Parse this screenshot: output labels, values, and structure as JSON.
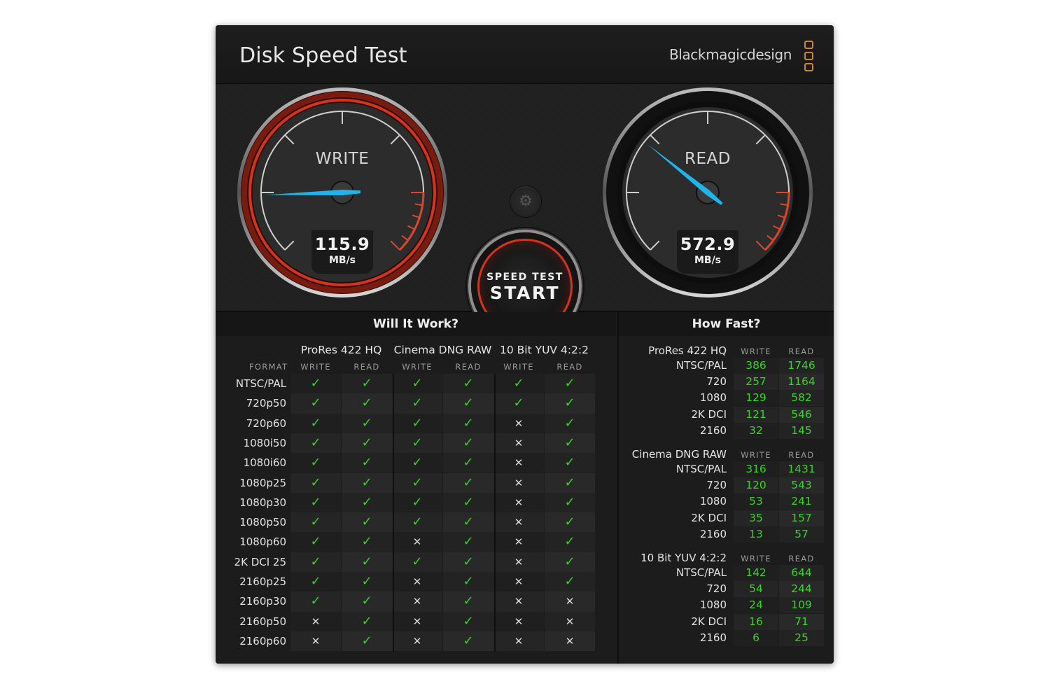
{
  "window": {
    "title": "Disk Speed Test",
    "brand": "Blackmagicdesign",
    "close_label": "×"
  },
  "gauges": {
    "write": {
      "label": "WRITE",
      "value": "115.9",
      "unit": "MB/s",
      "fraction": 0.16
    },
    "read": {
      "label": "READ",
      "value": "572.9",
      "unit": "MB/s",
      "fraction": 0.31
    }
  },
  "controls": {
    "settings_icon": "⚙",
    "start_small": "SPEED TEST",
    "start_big": "START"
  },
  "colors": {
    "accent_red": "#d3331f",
    "needle_blue": "#1fb4ea",
    "ok_green": "#3cd12a",
    "brand_orange": "#c48a3c"
  },
  "will_it_work": {
    "title": "Will It Work?",
    "format_label": "FORMAT",
    "groups": [
      "ProRes 422 HQ",
      "Cinema DNG RAW",
      "10 Bit YUV 4:2:2"
    ],
    "subheaders": [
      "WRITE",
      "READ",
      "WRITE",
      "READ",
      "WRITE",
      "READ"
    ],
    "ok_glyph": "✓",
    "no_glyph": "✕",
    "rows": [
      {
        "format": "NTSC/PAL",
        "results": [
          true,
          true,
          true,
          true,
          true,
          true
        ]
      },
      {
        "format": "720p50",
        "results": [
          true,
          true,
          true,
          true,
          true,
          true
        ]
      },
      {
        "format": "720p60",
        "results": [
          true,
          true,
          true,
          true,
          false,
          true
        ]
      },
      {
        "format": "1080i50",
        "results": [
          true,
          true,
          true,
          true,
          false,
          true
        ]
      },
      {
        "format": "1080i60",
        "results": [
          true,
          true,
          true,
          true,
          false,
          true
        ]
      },
      {
        "format": "1080p25",
        "results": [
          true,
          true,
          true,
          true,
          false,
          true
        ]
      },
      {
        "format": "1080p30",
        "results": [
          true,
          true,
          true,
          true,
          false,
          true
        ]
      },
      {
        "format": "1080p50",
        "results": [
          true,
          true,
          true,
          true,
          false,
          true
        ]
      },
      {
        "format": "1080p60",
        "results": [
          true,
          true,
          false,
          true,
          false,
          true
        ]
      },
      {
        "format": "2K DCI 25",
        "results": [
          true,
          true,
          true,
          true,
          false,
          true
        ]
      },
      {
        "format": "2160p25",
        "results": [
          true,
          true,
          false,
          true,
          false,
          true
        ]
      },
      {
        "format": "2160p30",
        "results": [
          true,
          true,
          false,
          true,
          false,
          false
        ]
      },
      {
        "format": "2160p50",
        "results": [
          false,
          true,
          false,
          true,
          false,
          false
        ]
      },
      {
        "format": "2160p60",
        "results": [
          false,
          true,
          false,
          true,
          false,
          false
        ]
      }
    ]
  },
  "how_fast": {
    "title": "How Fast?",
    "write_label": "WRITE",
    "read_label": "READ",
    "groups": [
      {
        "name": "ProRes 422 HQ",
        "rows": [
          {
            "format": "NTSC/PAL",
            "write": "386",
            "read": "1746"
          },
          {
            "format": "720",
            "write": "257",
            "read": "1164"
          },
          {
            "format": "1080",
            "write": "129",
            "read": "582"
          },
          {
            "format": "2K DCI",
            "write": "121",
            "read": "546"
          },
          {
            "format": "2160",
            "write": "32",
            "read": "145"
          }
        ]
      },
      {
        "name": "Cinema DNG RAW",
        "rows": [
          {
            "format": "NTSC/PAL",
            "write": "316",
            "read": "1431"
          },
          {
            "format": "720",
            "write": "120",
            "read": "543"
          },
          {
            "format": "1080",
            "write": "53",
            "read": "241"
          },
          {
            "format": "2K DCI",
            "write": "35",
            "read": "157"
          },
          {
            "format": "2160",
            "write": "13",
            "read": "57"
          }
        ]
      },
      {
        "name": "10 Bit YUV 4:2:2",
        "rows": [
          {
            "format": "NTSC/PAL",
            "write": "142",
            "read": "644"
          },
          {
            "format": "720",
            "write": "54",
            "read": "244"
          },
          {
            "format": "1080",
            "write": "24",
            "read": "109"
          },
          {
            "format": "2K DCI",
            "write": "16",
            "read": "71"
          },
          {
            "format": "2160",
            "write": "6",
            "read": "25"
          }
        ]
      }
    ]
  }
}
